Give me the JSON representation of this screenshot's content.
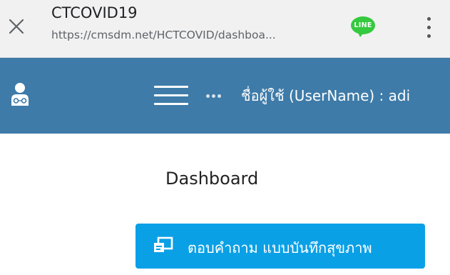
{
  "browser": {
    "site_title": "CTCOVID19",
    "url": "https://cmsdm.net/HCTCOVID/dashboa...",
    "line_badge_text": "LINE",
    "line_color": "#35c93e"
  },
  "navbar": {
    "background_color": "#3e7ba8",
    "username_label": "ชื่อผู้ใช้ (UserName) : adi"
  },
  "main": {
    "page_title": "Dashboard",
    "survey_button_label": "ตอบคำถาม แบบบันทึกสุขภาพ",
    "button_color": "#0aa0e6"
  },
  "icons": {
    "close": "close-icon",
    "line": "line-app-icon",
    "more": "more-vert-icon",
    "avatar": "doctor-avatar-icon",
    "menu": "hamburger-menu-icon",
    "dots": "more-horiz-icon",
    "survey": "form-icon"
  }
}
